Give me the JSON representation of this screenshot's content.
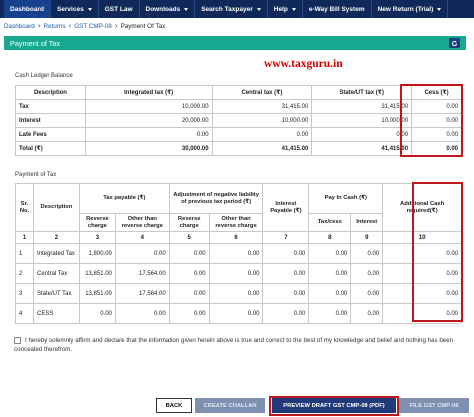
{
  "nav": {
    "items": [
      {
        "label": "Dashboard",
        "caret": false,
        "active": true
      },
      {
        "label": "Services",
        "caret": true,
        "active": false
      },
      {
        "label": "GST Law",
        "caret": false,
        "active": false
      },
      {
        "label": "Downloads",
        "caret": true,
        "active": false
      },
      {
        "label": "Search Taxpayer",
        "caret": true,
        "active": false
      },
      {
        "label": "Help",
        "caret": true,
        "active": false
      },
      {
        "label": "e-Way Bill System",
        "caret": false,
        "active": false
      },
      {
        "label": "New Return (Trial)",
        "caret": true,
        "active": false
      }
    ]
  },
  "breadcrumb": {
    "items": [
      "Dashboard",
      "Returns",
      "GST CMP-08"
    ],
    "current": "Payment Of Tax"
  },
  "header": {
    "title": "Payment of Tax",
    "refresh_icon": "refresh-icon"
  },
  "watermark": "www.taxguru.in",
  "ledger": {
    "section_label": "Cash Ledger Balance",
    "headers": [
      "Description",
      "Integrated tax (₹)",
      "Central tax (₹)",
      "State/UT tax (₹)",
      "Cess (₹)"
    ],
    "rows": [
      [
        "Tax",
        "10,000.00",
        "31,415.00",
        "31,415.00",
        "0.00"
      ],
      [
        "Interest",
        "20,000.00",
        "10,000.00",
        "10,000.00",
        "0.00"
      ],
      [
        "Late Fees",
        "0.00",
        "0.00",
        "0.00",
        "0.00"
      ],
      [
        "Total (₹)",
        "30,000.00",
        "41,415.00",
        "41,415.00",
        "0.00"
      ]
    ]
  },
  "payment": {
    "section_label": "Payment of Tax",
    "headers": {
      "sr_no": "Sr. No.",
      "description": "Description",
      "tax_payable": "Tax payable (₹)",
      "adjustment": "Adjustment of negative liability of previous tax period (₹)",
      "interest_payable": "Interest Payable (₹)",
      "pay_in_cash": "Pay In Cash (₹)",
      "additional_cash": "Additional Cash required(₹)",
      "reverse_charge": "Reverse charge",
      "other_than_reverse": "Other than reverse charge",
      "tax_cash": "Tax/cess",
      "interest": "Interest"
    },
    "col_numbers": [
      "1",
      "2",
      "3",
      "4",
      "5",
      "6",
      "7",
      "8",
      "9",
      "10"
    ],
    "rows": [
      {
        "sr": "1",
        "desc": "Integrated Tax",
        "rc": "1,800.00",
        "orc": "0.00",
        "adj_rc": "0.00",
        "adj_orc": "0.00",
        "int": "0.00",
        "tax": "0.00",
        "intc": "0.00",
        "add": "0.00"
      },
      {
        "sr": "2",
        "desc": "Central Tax",
        "rc": "13,851.00",
        "orc": "17,564.00",
        "adj_rc": "0.00",
        "adj_orc": "0.00",
        "int": "0.00",
        "tax": "0.00",
        "intc": "0.00",
        "add": "0.00"
      },
      {
        "sr": "3",
        "desc": "State/UT Tax",
        "rc": "13,851.00",
        "orc": "17,564.00",
        "adj_rc": "0.00",
        "adj_orc": "0.00",
        "int": "0.00",
        "tax": "0.00",
        "intc": "0.00",
        "add": "0.00"
      },
      {
        "sr": "4",
        "desc": "CESS",
        "rc": "0.00",
        "orc": "0.00",
        "adj_rc": "0.00",
        "adj_orc": "0.00",
        "int": "0.00",
        "tax": "0.00",
        "intc": "0.00",
        "add": "0.00"
      }
    ]
  },
  "declaration": "I hereby solemnly affirm and declare that the information given herein above is true and correct to the best of my knowledge and belief and nothing has been concealed therefrom.",
  "buttons": {
    "back": "BACK",
    "create_challan": "CREATE CHALLAN",
    "preview": "PREVIEW DRAFT GST CMP-08 (PDF)",
    "file": "FILE GST CMP-08"
  }
}
